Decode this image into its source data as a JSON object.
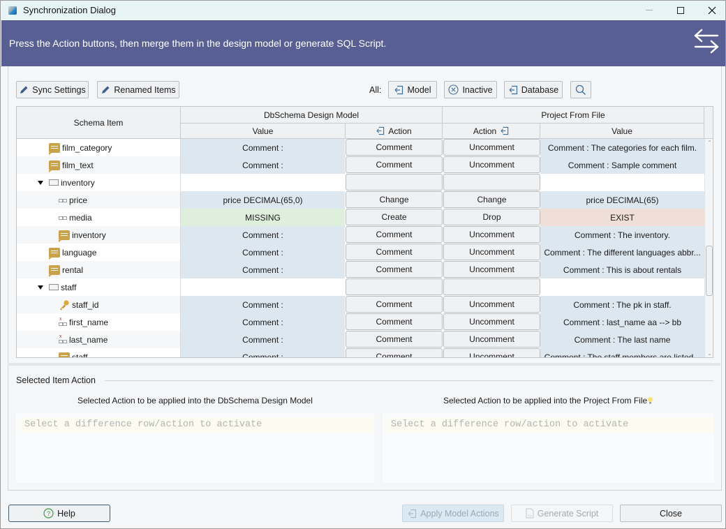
{
  "window": {
    "title": "Synchronization Dialog",
    "controls": {
      "minimize": "minimize",
      "maximize": "maximize",
      "close": "close"
    }
  },
  "banner": {
    "message": "Press the Action buttons, then merge them in the design model or generate SQL Script.",
    "icon": "swap-arrows-icon"
  },
  "toolbar": {
    "sync_settings": "Sync Settings",
    "renamed_items": "Renamed Items",
    "all_label": "All:",
    "model": "Model",
    "inactive": "Inactive",
    "database": "Database",
    "search_icon": "search-icon"
  },
  "table": {
    "headers": {
      "schema_item": "Schema Item",
      "left_group": "DbSchema Design Model",
      "right_group": "Project From File",
      "left_value": "Value",
      "left_action": "Action",
      "right_action": "Action",
      "right_value": "Value"
    },
    "rows": [
      {
        "name": "film_category",
        "icon": "comment-icon",
        "indent": 2,
        "left_value": "Comment :",
        "left_action": "Comment",
        "right_action": "Uncomment",
        "right_value": "Comment : The categories for each film.",
        "state": "diff"
      },
      {
        "name": "film_text",
        "icon": "comment-icon",
        "indent": 2,
        "left_value": "Comment :",
        "left_action": "Comment",
        "right_action": "Uncomment",
        "right_value": "Comment : Sample comment",
        "state": "diff"
      },
      {
        "name": "inventory",
        "icon": "table-icon",
        "indent": 1,
        "expanded": true,
        "left_value": "",
        "left_action": "",
        "right_action": "",
        "right_value": "",
        "state": "blank"
      },
      {
        "name": "price",
        "icon": "column-icon",
        "indent": 3,
        "left_value": "price DECIMAL(65,0)",
        "left_action": "Change",
        "right_action": "Change",
        "right_value": "price DECIMAL(65)",
        "state": "diff"
      },
      {
        "name": "media",
        "icon": "column-icon",
        "indent": 3,
        "left_value": "MISSING",
        "left_action": "Create",
        "right_action": "Drop",
        "right_value": "EXIST",
        "state": "missing"
      },
      {
        "name": "inventory",
        "icon": "comment-icon",
        "indent": 3,
        "left_value": "Comment :",
        "left_action": "Comment",
        "right_action": "Uncomment",
        "right_value": "Comment : The inventory.",
        "state": "diff"
      },
      {
        "name": "language",
        "icon": "comment-icon",
        "indent": 2,
        "left_value": "Comment :",
        "left_action": "Comment",
        "right_action": "Uncomment",
        "right_value": "Comment : The different languages abbr...",
        "state": "diff"
      },
      {
        "name": "rental",
        "icon": "comment-icon",
        "indent": 2,
        "left_value": "Comment :",
        "left_action": "Comment",
        "right_action": "Uncomment",
        "right_value": "Comment : This is about rentals",
        "state": "diff"
      },
      {
        "name": "staff",
        "icon": "table-icon",
        "indent": 1,
        "expanded": true,
        "left_value": "",
        "left_action": "",
        "right_action": "",
        "right_value": "",
        "state": "blank"
      },
      {
        "name": "staff_id",
        "icon": "key-icon",
        "indent": 3,
        "left_value": "Comment :",
        "left_action": "Comment",
        "right_action": "Uncomment",
        "right_value": "Comment : The pk in staff.",
        "state": "diff"
      },
      {
        "name": "first_name",
        "icon": "not-null-column-icon",
        "indent": 3,
        "left_value": "Comment :",
        "left_action": "Comment",
        "right_action": "Uncomment",
        "right_value": "Comment : last_name aa --> bb",
        "state": "diff"
      },
      {
        "name": "last_name",
        "icon": "not-null-column-icon",
        "indent": 3,
        "left_value": "Comment :",
        "left_action": "Comment",
        "right_action": "Uncomment",
        "right_value": "Comment : The last name",
        "state": "diff"
      },
      {
        "name": "staff",
        "icon": "comment-icon",
        "indent": 3,
        "left_value": "Comment :",
        "left_action": "Comment",
        "right_action": "Uncomment",
        "right_value": "Comment : The staff members are listed...",
        "state": "diff"
      }
    ]
  },
  "selected_action": {
    "section_title": "Selected Item Action",
    "left_title": "Selected Action to be applied into the DbSchema Design Model",
    "right_title": "Selected Action to be applied into the Project From File",
    "left_placeholder": "Select a difference row/action to activate",
    "right_placeholder": "Select a difference row/action to activate"
  },
  "footer": {
    "help": "Help",
    "apply_model_actions": "Apply Model Actions",
    "generate_script": "Generate Script",
    "close": "Close"
  },
  "colors": {
    "banner": "#586093",
    "value_cell": "#dde7f0",
    "missing_cell": "#deefdc",
    "exist_cell": "#efdfd6",
    "comment_icon": "#c9a24a"
  }
}
